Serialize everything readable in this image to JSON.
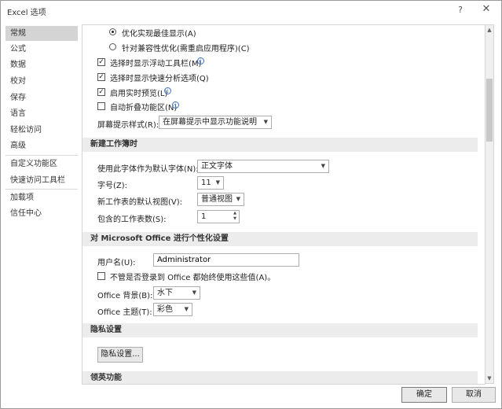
{
  "window": {
    "title": "Excel 选项",
    "help": "?",
    "close": "✕"
  },
  "nav": {
    "items": [
      "常规",
      "公式",
      "数据",
      "校对",
      "保存",
      "语言",
      "轻松访问",
      "高级",
      "自定义功能区",
      "快速访问工具栏",
      "加载项",
      "信任中心"
    ],
    "selected": "常规"
  },
  "general": {
    "optimize_display": "优化实现最佳显示(A)",
    "optimize_compat": "针对兼容性优化(需重启应用程序)(C)",
    "show_mini_toolbar": "选择时显示浮动工具栏(M)",
    "show_quick_analysis": "选择时显示快速分析选项(Q)",
    "enable_live_preview": "启用实时预览(L)",
    "collapse_ribbon": "自动折叠功能区(N)",
    "screentip_label": "屏幕提示样式(R):",
    "screentip_value": "在屏幕提示中显示功能说明",
    "checks": {
      "mini_toolbar": "✓",
      "quick_analysis": "✓",
      "live_preview": "✓",
      "collapse_ribbon": ""
    }
  },
  "new_workbook": {
    "header": "新建工作簿时",
    "font_label": "使用此字体作为默认字体(N):",
    "font_value": "正文字体",
    "size_label": "字号(Z):",
    "size_value": "11",
    "view_label": "新工作表的默认视图(V):",
    "view_value": "普通视图",
    "sheets_label": "包含的工作表数(S):",
    "sheets_value": "1"
  },
  "personalize": {
    "header": "对 Microsoft Office 进行个性化设置",
    "username_label": "用户名(U):",
    "username_value": "Administrator",
    "always_use": "不管是否登录到 Office 都始终使用这些值(A)。",
    "background_label": "Office 背景(B):",
    "background_value": "水下",
    "theme_label": "Office 主题(T):",
    "theme_value": "彩色"
  },
  "privacy": {
    "header": "隐私设置",
    "button": "隐私设置..."
  },
  "startup": {
    "header": "领英功能"
  },
  "footer": {
    "ok": "确定",
    "cancel": "取消"
  },
  "icons": {
    "info": "i",
    "dropdown": "▼",
    "spin_up": "▲",
    "spin_down": "▼",
    "scroll_up": "▲",
    "scroll_down": "▼"
  },
  "colors": {
    "selected_nav": "#d4d4d4",
    "section_bg": "#ececec",
    "info_blue": "#3a72c4"
  }
}
